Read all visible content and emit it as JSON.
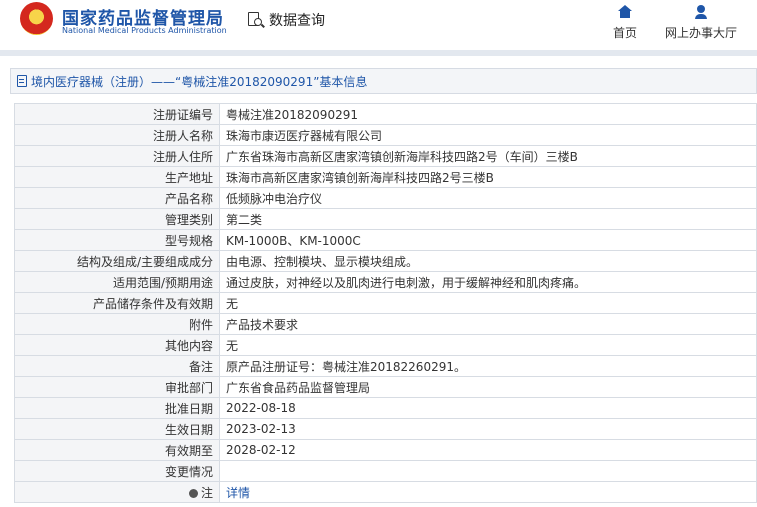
{
  "header": {
    "site_name": "国家药品监督管理局",
    "site_name_en": "National Medical Products Administration",
    "query_label": "数据查询",
    "nav": [
      {
        "label": "首页",
        "icon": "home-icon"
      },
      {
        "label": "网上办事大厅",
        "icon": "user-icon"
      }
    ],
    "brand_color": "#1f56a8"
  },
  "breadcrumb": {
    "text": "境内医疗器械（注册）——“粤械注准20182090291”基本信息"
  },
  "rows": [
    {
      "label": "注册证编号",
      "value": "粤械注准20182090291"
    },
    {
      "label": "注册人名称",
      "value": "珠海市康迈医疗器械有限公司"
    },
    {
      "label": "注册人住所",
      "value": "广东省珠海市高新区唐家湾镇创新海岸科技四路2号（车间）三楼B"
    },
    {
      "label": "生产地址",
      "value": "珠海市高新区唐家湾镇创新海岸科技四路2号三楼B"
    },
    {
      "label": "产品名称",
      "value": "低频脉冲电治疗仪"
    },
    {
      "label": "管理类别",
      "value": "第二类"
    },
    {
      "label": "型号规格",
      "value": "KM-1000B、KM-1000C"
    },
    {
      "label": "结构及组成/主要组成成分",
      "value": "由电源、控制模块、显示模块组成。"
    },
    {
      "label": "适用范围/预期用途",
      "value": "通过皮肤，对神经以及肌肉进行电刺激，用于缓解神经和肌肉疼痛。"
    },
    {
      "label": "产品储存条件及有效期",
      "value": "无"
    },
    {
      "label": "附件",
      "value": "产品技术要求"
    },
    {
      "label": "其他内容",
      "value": "无"
    },
    {
      "label": "备注",
      "value": "原产品注册证号：粤械注准20182260291。"
    },
    {
      "label": "审批部门",
      "value": "广东省食品药品监督管理局"
    },
    {
      "label": "批准日期",
      "value": "2022-08-18"
    },
    {
      "label": "生效日期",
      "value": "2023-02-13"
    },
    {
      "label": "有效期至",
      "value": "2028-02-12"
    },
    {
      "label": "变更情况",
      "value": ""
    }
  ],
  "note_row": {
    "label": "注",
    "link_text": "详情"
  }
}
